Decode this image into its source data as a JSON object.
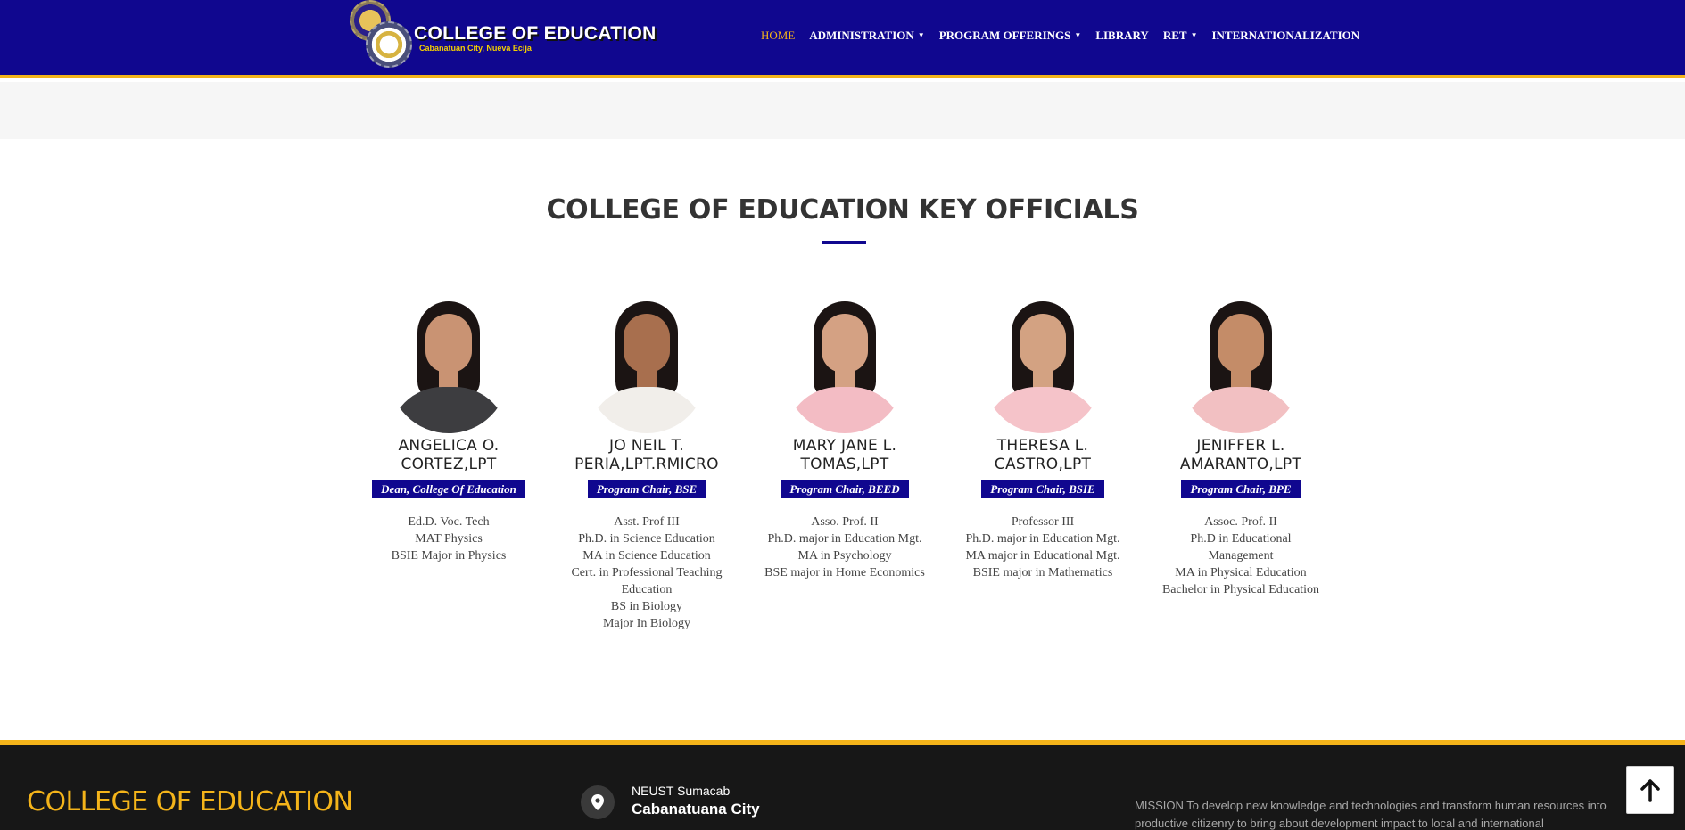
{
  "header": {
    "brand_title": "COLLEGE OF EDUCATION",
    "brand_subtitle": "Cabanatuan City, Nueva Ecija",
    "nav": [
      {
        "label": "HOME",
        "active": true,
        "dropdown": false
      },
      {
        "label": "ADMINISTRATION",
        "active": false,
        "dropdown": true
      },
      {
        "label": "PROGRAM OFFERINGS",
        "active": false,
        "dropdown": true
      },
      {
        "label": "LIBRARY",
        "active": false,
        "dropdown": false
      },
      {
        "label": "RET",
        "active": false,
        "dropdown": true
      },
      {
        "label": "INTERNATIONALIZATION",
        "active": false,
        "dropdown": false
      }
    ]
  },
  "section": {
    "title": "COLLEGE OF EDUCATION KEY OFFICIALS"
  },
  "officials": [
    {
      "name_line1": "ANGELICA O.",
      "name_line2": "CORTEZ,LPT",
      "role": "Dean, College Of Education",
      "credentials": [
        "Ed.D. Voc. Tech",
        "MAT Physics",
        "BSIE Major in Physics"
      ],
      "top_color": "#3d3d40",
      "skin_color": "#c99373"
    },
    {
      "name_line1": "JO NEIL T.",
      "name_line2": "PERIA,LPT.RMICRO",
      "role": "Program Chair, BSE",
      "credentials": [
        "Asst. Prof III",
        "Ph.D. in Science Education",
        "MA in Science Education",
        "Cert. in Professional Teaching",
        "Education",
        "BS in Biology",
        "Major In Biology"
      ],
      "top_color": "#f1eeea",
      "skin_color": "#a86f4e"
    },
    {
      "name_line1": "MARY JANE L.",
      "name_line2": "TOMAS,LPT",
      "role": "Program Chair, BEED",
      "credentials": [
        "Asso. Prof. II",
        "Ph.D. major in Education Mgt.",
        "MA in Psychology",
        "BSE major in Home Economics"
      ],
      "top_color": "#f3bcc4",
      "skin_color": "#d4a183"
    },
    {
      "name_line1": "THERESA L.",
      "name_line2": "CASTRO,LPT",
      "role": "Program Chair, BSIE",
      "credentials": [
        "Professor III",
        "Ph.D. major in Education Mgt.",
        "MA major in Educational Mgt.",
        "BSIE major in Mathematics"
      ],
      "top_color": "#f5c3c9",
      "skin_color": "#d3a282"
    },
    {
      "name_line1": "JENIFFER L.",
      "name_line2": "AMARANTO,LPT",
      "role": "Program Chair, BPE",
      "credentials": [
        "Assoc. Prof. II",
        "Ph.D in Educational",
        "Management",
        "MA in Physical Education",
        "Bachelor in Physical Education"
      ],
      "top_color": "#f2c0c2",
      "skin_color": "#c48c68"
    }
  ],
  "footer": {
    "title": "COLLEGE OF EDUCATION",
    "location_line1": "NEUST Sumacab",
    "location_line2": "Cabanatuana City",
    "mission": "MISSION To develop new knowledge and technologies and transform human resources into productive citizenry to bring about development impact to local and international"
  },
  "icons": {
    "location": "map-pin-icon",
    "back_to_top": "arrow-up-icon"
  },
  "colors": {
    "navy": "#10078f",
    "gold": "#f4b41a",
    "footer_bg": "#171717"
  }
}
